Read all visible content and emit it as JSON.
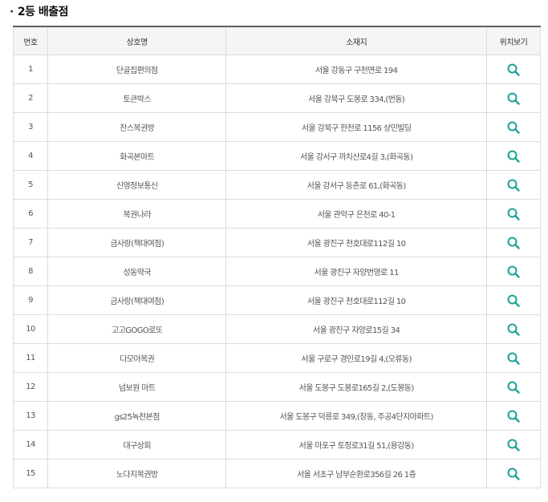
{
  "section": {
    "bullet": "·",
    "title": "2등 배출점"
  },
  "colors": {
    "accent": "#1aa199",
    "header_bg": "#f5f5f5",
    "border": "#dcdcdc"
  },
  "table": {
    "headers": {
      "no": "번호",
      "name": "상호명",
      "address": "소재지",
      "map": "위치보기"
    },
    "map_icon": "search-icon",
    "rows": [
      {
        "no": "1",
        "name": "단골집편의점",
        "address": "서울 강동구 구천면로 194"
      },
      {
        "no": "2",
        "name": "토큰박스",
        "address": "서울 강북구 도봉로 334,(번동)"
      },
      {
        "no": "3",
        "name": "찬스복권방",
        "address": "서울 강북구 한천로 1156 상민빌딩"
      },
      {
        "no": "4",
        "name": "화곡본마트",
        "address": "서울 강서구 까치산로4길 3,(화곡동)"
      },
      {
        "no": "5",
        "name": "신영정보통신",
        "address": "서울 강서구 등촌로 61,(화곡동)"
      },
      {
        "no": "6",
        "name": "복권나라",
        "address": "서울 관악구 은천로 40-1"
      },
      {
        "no": "7",
        "name": "금사랑(책대여점)",
        "address": "서울 광진구 천호대로112길 10"
      },
      {
        "no": "8",
        "name": "성동약국",
        "address": "서울 광진구 자양번영로 11"
      },
      {
        "no": "9",
        "name": "금사랑(책대여점)",
        "address": "서울 광진구 천호대로112길 10"
      },
      {
        "no": "10",
        "name": "고고GOGO로또",
        "address": "서울 광진구 자양로15길 34"
      },
      {
        "no": "11",
        "name": "다모아복권",
        "address": "서울 구로구 경인로19길 4,(오류동)"
      },
      {
        "no": "12",
        "name": "넘보원 마트",
        "address": "서울 도봉구 도봉로165길 2,(도봉동)"
      },
      {
        "no": "13",
        "name": "gs25녹천본점",
        "address": "서울 도봉구 덕릉로 349,(창동, 주공4단지아파트)"
      },
      {
        "no": "14",
        "name": "대구상회",
        "address": "서울 마포구 토정로31길 51,(용강동)"
      },
      {
        "no": "15",
        "name": "노다지복권방",
        "address": "서울 서초구 남부순환로356길 26 1층"
      }
    ]
  }
}
